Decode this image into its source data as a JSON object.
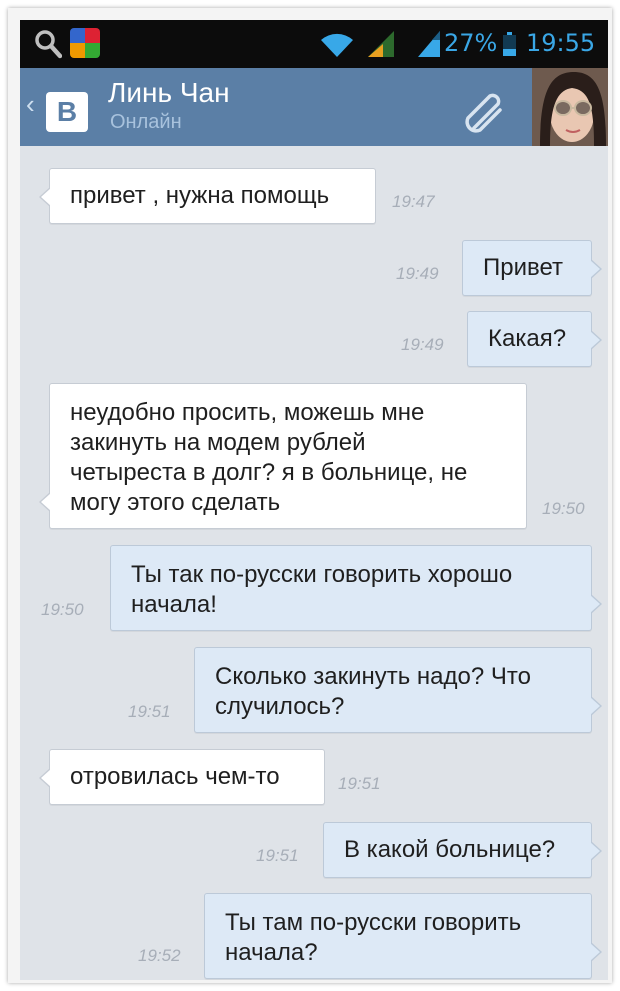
{
  "status_bar": {
    "battery": "27%",
    "time": "19:55",
    "icons": [
      "search-icon",
      "app-notification-icon",
      "wifi-icon",
      "signal-icon",
      "signal-icon",
      "battery-icon"
    ]
  },
  "header": {
    "back_icon": "chevron-left-icon",
    "logo": "В",
    "contact_name": "Линь Чан",
    "contact_status": "Онлайн",
    "attach_icon": "paperclip-icon"
  },
  "colors": {
    "header_bg": "#5b7fa6",
    "status_accent": "#38a8e8",
    "incoming_bubble": "#ffffff",
    "outgoing_bubble": "#dde9f6",
    "chat_bg": "#dfe3e8"
  },
  "messages": [
    {
      "dir": "in",
      "text": "привет , нужна помощь",
      "time": "19:47"
    },
    {
      "dir": "out",
      "text": "Привет",
      "time": "19:49"
    },
    {
      "dir": "out",
      "text": "Какая?",
      "time": "19:49"
    },
    {
      "dir": "in",
      "lines": [
        "неудобно просить, можешь мне",
        "закинуть на модем рублей",
        "четыреста в долг? я в больнице, не",
        "могу этого сделать"
      ],
      "time": "19:50"
    },
    {
      "dir": "out",
      "lines": [
        "Ты так по-русски говорить хорошо",
        "начала!"
      ],
      "time": "19:50"
    },
    {
      "dir": "out",
      "lines": [
        "Сколько закинуть надо? Что",
        "случилось?"
      ],
      "time": "19:51"
    },
    {
      "dir": "in",
      "text": "отровилась чем-то",
      "time": "19:51"
    },
    {
      "dir": "out",
      "text": "В какой больнице?",
      "time": "19:51"
    },
    {
      "dir": "out",
      "lines": [
        "Ты там по-русски говорить",
        "начала?"
      ],
      "time": "19:52"
    }
  ]
}
